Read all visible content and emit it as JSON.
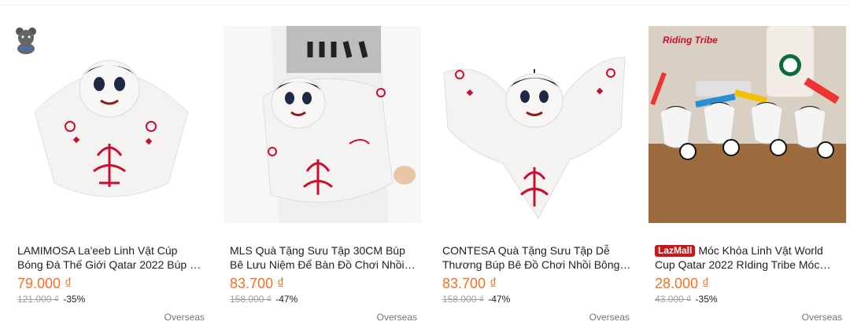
{
  "products": [
    {
      "title": "LAMIMOSA La'eeb Linh Vật Cúp Bóng Đá Thế Giới Qatar 2022 Búp Bê Nhồi Bông",
      "price": "79.000 ₫",
      "original_price": "121.000 ₫",
      "discount": "-35%",
      "location": "Overseas",
      "image_icon": "laeeb-mascot-plush-image"
    },
    {
      "title": "MLS Quà Tặng Sưu Tập 30CM Búp Bê Lưu Niệm Để Bàn Đồ Chơi Nhồi Bông",
      "price": "83.700 ₫",
      "original_price": "158.000 ₫",
      "discount": "-47%",
      "location": "Overseas",
      "image_icon": "laeeb-mascot-held-image"
    },
    {
      "title": "CONTESA Quà Tặng Sưu Tập Dễ Thương Búp Bê Đồ Chơi Nhồi Bông Linh Vật",
      "price": "83.700 ₫",
      "original_price": "158.000 ₫",
      "discount": "-47%",
      "location": "Overseas",
      "image_icon": "laeeb-mascot-spread-image"
    },
    {
      "badge": "LazMall",
      "title": "Móc Khóa Linh Vật World Cup Qatar 2022 RIding Tribe Móc Khóa",
      "price": "28.000 ₫",
      "original_price": "43.000 ₫",
      "discount": "-35%",
      "location": "Overseas",
      "image_icon": "keychain-mascots-image",
      "image_brand_text": "Riding Tribe"
    }
  ],
  "colors": {
    "price": "#f57224",
    "lazmall": "#c9161c",
    "muted": "#9e9e9e",
    "accent_red": "#c8102e"
  }
}
